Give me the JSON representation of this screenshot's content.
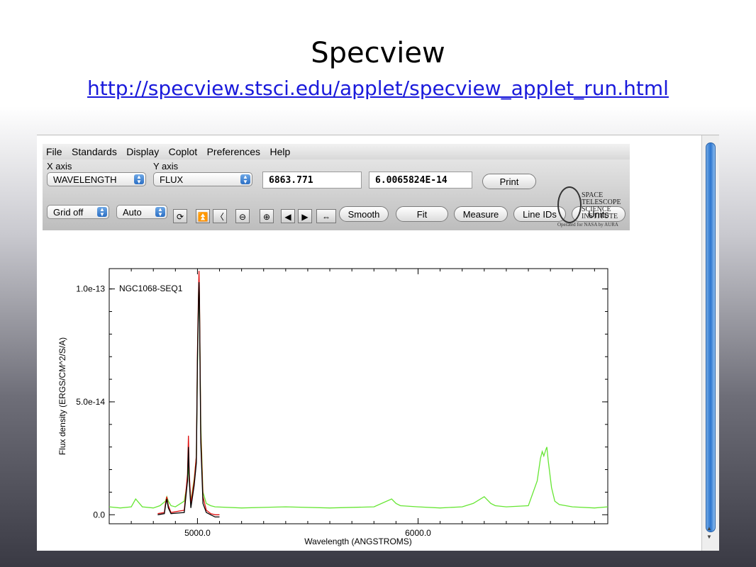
{
  "slide": {
    "title": "Specview",
    "link": "http://specview.stsci.edu/applet/specview_applet_run.html"
  },
  "menu": [
    "File",
    "Standards",
    "Display",
    "Coplot",
    "Preferences",
    "Help"
  ],
  "toolbar": {
    "x_axis_label": "X axis",
    "y_axis_label": "Y axis",
    "x_axis_value": "WAVELENGTH",
    "y_axis_value": "FLUX",
    "x_readout": "6863.771",
    "y_readout": "6.0065824E-14",
    "print_label": "Print",
    "grid_value": "Grid off",
    "scale_value": "Auto",
    "buttons": [
      "Smooth",
      "Fit",
      "Measure",
      "Line IDs",
      "Units"
    ],
    "icons": [
      "refresh-icon",
      "move-to-top-icon",
      "back-icon",
      "zoom-out-icon",
      "zoom-in-icon",
      "arrow-left-icon",
      "arrow-right-icon",
      "expand-horizontal-icon"
    ]
  },
  "logo": {
    "lines": [
      "SPACE",
      "TELESCOPE",
      "SCIENCE",
      "INSTITUTE"
    ],
    "sub": "Operated for NASA by AURA"
  },
  "colors": {
    "link": "#1a1adb",
    "series_green": "#66e633",
    "series_red": "#e01010",
    "series_black": "#000000",
    "select_arrows": "#2b6fc4"
  },
  "chart_data": {
    "type": "line",
    "title": "NGC1068-SEQ1",
    "xlabel": "Wavelength (ANGSTROMS)",
    "ylabel": "Flux density (ERGS/CM^2/S/A)",
    "xlim": [
      4600,
      6860
    ],
    "ylim": [
      -4e-15,
      1.09e-13
    ],
    "x_ticks": [
      5000,
      6000
    ],
    "x_tick_labels": [
      "5000.0",
      "6000.0"
    ],
    "y_ticks": [
      0,
      5e-14,
      1e-13
    ],
    "y_tick_labels": [
      "0.0",
      "5.0e-14",
      "1.0e-13"
    ],
    "grid": false,
    "series": [
      {
        "color": "#66e633",
        "x": [
          4600,
          4650,
          4700,
          4720,
          4750,
          4800,
          4830,
          4855,
          4861,
          4868,
          4880,
          4900,
          4940,
          4955,
          4959,
          4963,
          4970,
          4985,
          4995,
          5000,
          5005,
          5007,
          5009,
          5015,
          5025,
          5040,
          5060,
          5080,
          5200,
          5400,
          5600,
          5800,
          5880,
          5900,
          5920,
          6000,
          6100,
          6200,
          6250,
          6300,
          6330,
          6350,
          6400,
          6500,
          6540,
          6555,
          6563,
          6570,
          6580,
          6584,
          6590,
          6605,
          6620,
          6640,
          6700,
          6800,
          6860
        ],
        "y": [
          3.5e-15,
          3e-15,
          3.5e-15,
          7e-15,
          3.5e-15,
          3e-15,
          4e-15,
          6e-15,
          8e-15,
          6e-15,
          4e-15,
          3.5e-15,
          6e-15,
          1.5e-14,
          2.2e-14,
          1.5e-14,
          6e-15,
          1.6e-14,
          2.6e-14,
          6.5e-14,
          9.8e-14,
          1.02e-13,
          9.6e-14,
          4e-14,
          1e-14,
          5e-15,
          4e-15,
          3.5e-15,
          3e-15,
          3.5e-15,
          3e-15,
          3.5e-15,
          7e-15,
          5e-15,
          4e-15,
          3.5e-15,
          3e-15,
          3.5e-15,
          5e-15,
          8e-15,
          5e-15,
          4e-15,
          3.5e-15,
          4e-15,
          1.5e-14,
          2.5e-14,
          2.8e-14,
          2.6e-14,
          2.9e-14,
          3e-14,
          2.4e-14,
          1.2e-14,
          6e-15,
          4.5e-15,
          3.5e-15,
          3e-15,
          3.5e-15
        ]
      },
      {
        "color": "#e01010",
        "x": [
          4820,
          4850,
          4855,
          4861,
          4868,
          4880,
          4940,
          4955,
          4959,
          4963,
          4970,
          4985,
          4995,
          5000,
          5005,
          5007,
          5009,
          5015,
          5025,
          5040,
          5060,
          5080,
          5100
        ],
        "y": [
          5e-16,
          1e-15,
          5e-15,
          8e-15,
          4e-15,
          1e-15,
          2e-15,
          1.8e-14,
          3.5e-14,
          1.8e-14,
          5e-15,
          1.5e-14,
          2.6e-14,
          7.2e-14,
          1e-13,
          1.08e-13,
          9.9e-14,
          3.6e-14,
          8e-15,
          2e-15,
          5e-16,
          0.0,
          0.0
        ]
      },
      {
        "color": "#000000",
        "x": [
          4820,
          4850,
          4855,
          4861,
          4868,
          4880,
          4940,
          4955,
          4959,
          4963,
          4970,
          4985,
          4995,
          5000,
          5005,
          5007,
          5009,
          5015,
          5025,
          5040,
          5060,
          5080,
          5100
        ],
        "y": [
          0.0,
          5e-16,
          4e-15,
          7e-15,
          3e-15,
          5e-16,
          1e-15,
          1.5e-14,
          3e-14,
          1.5e-14,
          3e-15,
          1.3e-14,
          2.3e-14,
          6.8e-14,
          9.6e-14,
          1.03e-13,
          9.5e-14,
          3.2e-14,
          5e-15,
          1e-15,
          0.0,
          -1e-15,
          -1e-15
        ]
      }
    ]
  }
}
